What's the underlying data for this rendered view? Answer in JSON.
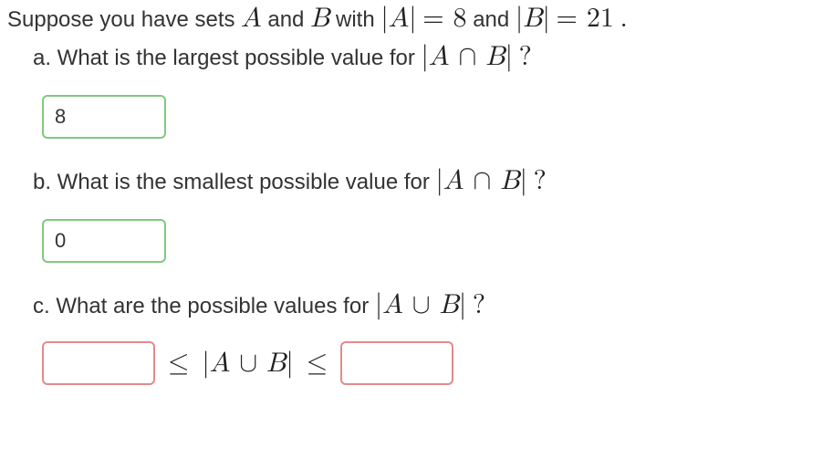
{
  "intro": {
    "prefix": "Suppose you have sets ",
    "A": "A",
    "and1": " and ",
    "B": "B",
    "with": " with ",
    "eqA_lhs": "|A|",
    "eqA_eq": " = ",
    "eqA_rhs": "8",
    "and2": " and ",
    "eqB_lhs": "|B|",
    "eqB_eq": " = ",
    "eqB_rhs": "21",
    "period": "."
  },
  "parts": {
    "a": {
      "label": "a. What is the largest possible value for ",
      "expr": "|A ∩ B|",
      "q": "?",
      "answer": "8"
    },
    "b": {
      "label": "b. What is the smallest possible value for ",
      "expr": "|A ∩ B|",
      "q": "?",
      "answer": "0"
    },
    "c": {
      "label": "c. What are the possible values for ",
      "expr": "|A ∪ B|",
      "q": "?",
      "leq1": "≤",
      "mid": "|A ∪ B|",
      "leq2": "≤",
      "low": "",
      "high": ""
    }
  }
}
